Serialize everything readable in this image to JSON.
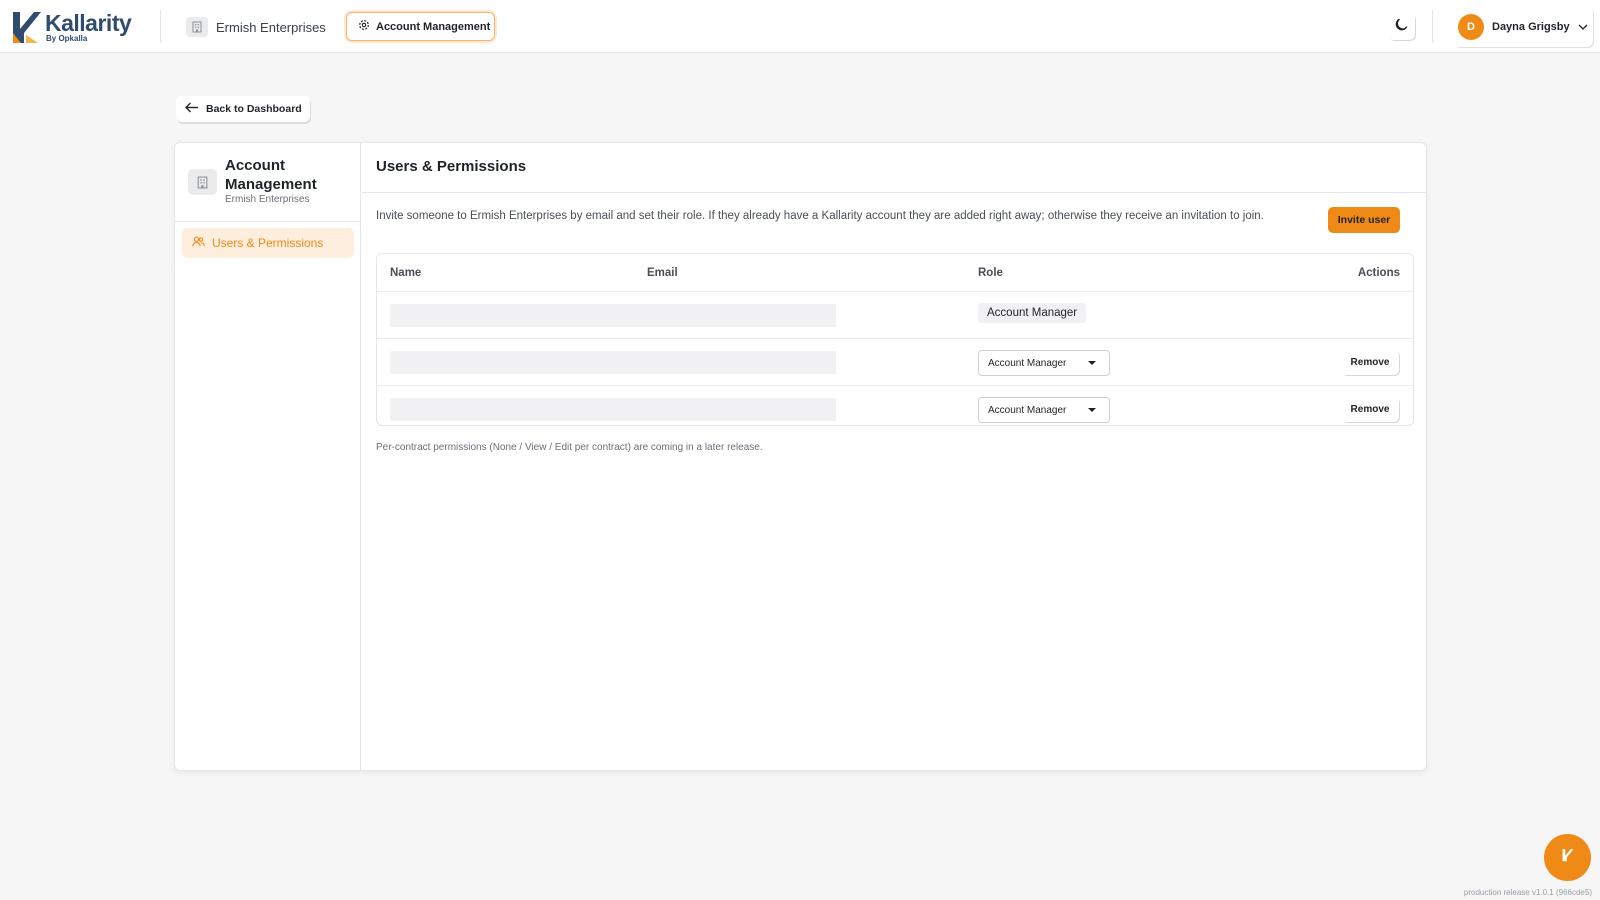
{
  "brand": {
    "name": "Kallarity",
    "tagline": "By Opkalla"
  },
  "header": {
    "org_name": "Ermish Enterprises",
    "active_section": "Account Management",
    "user": {
      "initial": "D",
      "name": "Dayna Grigsby"
    }
  },
  "back_label": "Back to Dashboard",
  "sidebar": {
    "title": "Account Management",
    "subtitle": "Ermish Enterprises",
    "items": [
      {
        "label": "Users & Permissions",
        "active": true
      }
    ]
  },
  "main": {
    "title": "Users & Permissions",
    "intro": "Invite someone to Ermish Enterprises by email and set their role. If they already have a Kallarity account they are added right away; otherwise they receive an invitation to join.",
    "invite_label": "Invite user",
    "table": {
      "columns": [
        "Name",
        "Email",
        "Role",
        "Actions"
      ],
      "rows": [
        {
          "role": "Account Manager",
          "editable": false
        },
        {
          "role": "Account Manager",
          "editable": true,
          "action": "Remove"
        },
        {
          "role": "Account Manager",
          "editable": true,
          "action": "Remove"
        }
      ]
    },
    "footnote": "Per-contract permissions (None / View / Edit per contract) are coming in a later release."
  },
  "release": "production release v1.0.1 (966cde5)",
  "colors": {
    "accent": "#ef8a16",
    "brand": "#2f4c6e"
  }
}
